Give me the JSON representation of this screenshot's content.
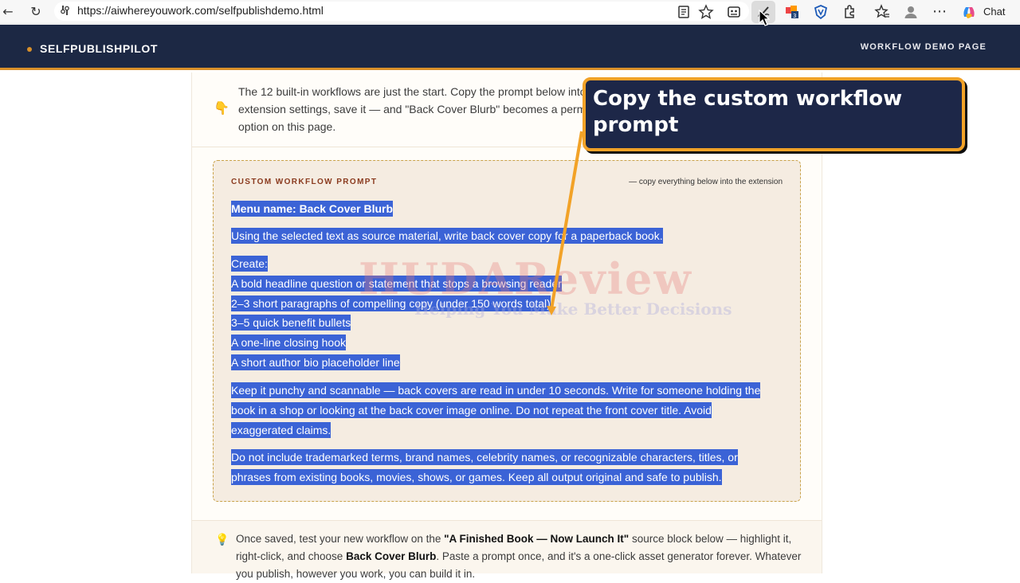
{
  "browser": {
    "url": "https://aiwhereyouwork.com/selfpublishdemo.html",
    "chat_label": "Chat"
  },
  "header": {
    "brand": "SELFPUBLISHPILOT",
    "right_label": "WORKFLOW DEMO PAGE"
  },
  "intro": {
    "icon": "👇",
    "text": "The 12 built-in workflows are just the start. Copy the prompt below into the extension settings, save it — and \"Back Cover Blurb\" becomes a permanent option on this page."
  },
  "prompt_box": {
    "label": "CUSTOM WORKFLOW PROMPT",
    "hint": "— copy everything below into the extension",
    "menu_name": "Menu name: Back Cover Blurb",
    "instruction": "Using the selected text as source material, write back cover copy for a paperback book.",
    "create_heading": "Create:",
    "create_items": [
      "A bold headline question or statement that stops a browsing reader",
      "2–3 short paragraphs of compelling copy (under 150 words total)",
      "3–5 quick benefit bullets",
      "A one-line closing hook",
      "A short author bio placeholder line"
    ],
    "para_1_lines": [
      "Keep it punchy and scannable — back covers are read in under 10 seconds. Write for someone holding the",
      "book in a shop or looking at the back cover image online. Do not repeat the front cover title. Avoid",
      "exaggerated claims."
    ],
    "para_2_lines": [
      "Do not include trademarked terms, brand names, celebrity names, or recognizable characters, titles, or",
      "phrases from existing books, movies, shows, or games. Keep all output original and safe to publish."
    ]
  },
  "tip": {
    "icon": "💡",
    "prefix": "Once saved, test your new workflow on the ",
    "source_block": "\"A Finished Book — Now Launch It\"",
    "middle": " source block below — highlight it, right-click, and choose ",
    "workflow": "Back Cover Blurb",
    "suffix": ". Paste a prompt once, and it's a one-click asset generator forever. Whatever you publish, however you work, you can build it in."
  },
  "watermark": {
    "main": "HUDAReview",
    "sub": "Helping You Make Better Decisions"
  },
  "callout": {
    "text": "Copy the custom workflow prompt"
  },
  "colors": {
    "header_bg": "#1c2844",
    "accent": "#d9902a",
    "selection": "#3b63d6",
    "callout_bg": "#1d2748",
    "callout_border": "#f2a227"
  }
}
